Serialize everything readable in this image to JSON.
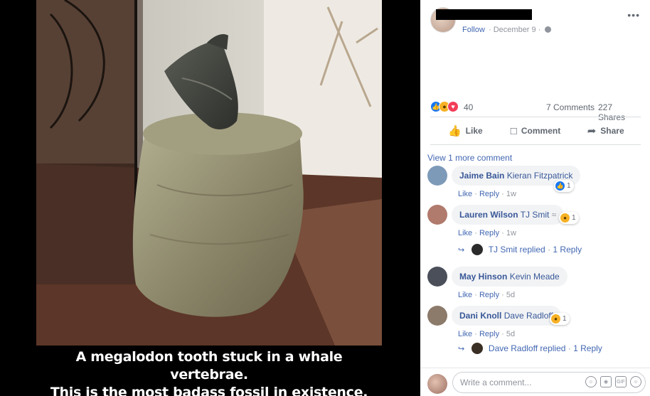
{
  "media": {
    "caption_line1": "A megalodon tooth stuck in a whale vertebrae.",
    "caption_line2": "This is the most badass fossil in existence."
  },
  "post": {
    "follow_label": "Follow",
    "date": "December 9",
    "separator": "·",
    "more_label": "•••",
    "reaction_count": "40",
    "comments_count": "7 Comments",
    "shares_count": "227 Shares"
  },
  "actions": {
    "like": "Like",
    "comment": "Comment",
    "share": "Share"
  },
  "comments_section": {
    "view_more": "View 1 more comment",
    "items": [
      {
        "name": "Jaime Bain",
        "tag": "Kieran Fitzpatrick",
        "like": "Like",
        "reply": "Reply",
        "time": "1w",
        "reaction_count": "1",
        "avatar_color": "#7d9ab8"
      },
      {
        "name": "Lauren Wilson",
        "tag": "TJ Smit",
        "like": "Like",
        "reply": "Reply",
        "time": "1w",
        "reaction_count": "1",
        "avatar_color": "#b07a6c",
        "reply_summary": "TJ Smit replied",
        "reply_count": "1 Reply"
      },
      {
        "name": "May Hinson",
        "tag": "Kevin Meade",
        "like": "Like",
        "reply": "Reply",
        "time": "5d",
        "avatar_color": "#4a4f59"
      },
      {
        "name": "Dani Knoll",
        "tag": "Dave Radloff",
        "like": "Like",
        "reply": "Reply",
        "time": "5d",
        "reaction_count": "1",
        "avatar_color": "#8c7a6a",
        "reply_summary": "Dave Radloff replied",
        "reply_count": "1 Reply"
      }
    ]
  },
  "composer": {
    "placeholder": "Write a comment...",
    "gif_label": "GIF"
  },
  "colors": {
    "link": "#4267b2",
    "name": "#385898",
    "like_blue": "#1877f2",
    "wow_yellow": "#f7b125",
    "love_red": "#f33e58"
  }
}
